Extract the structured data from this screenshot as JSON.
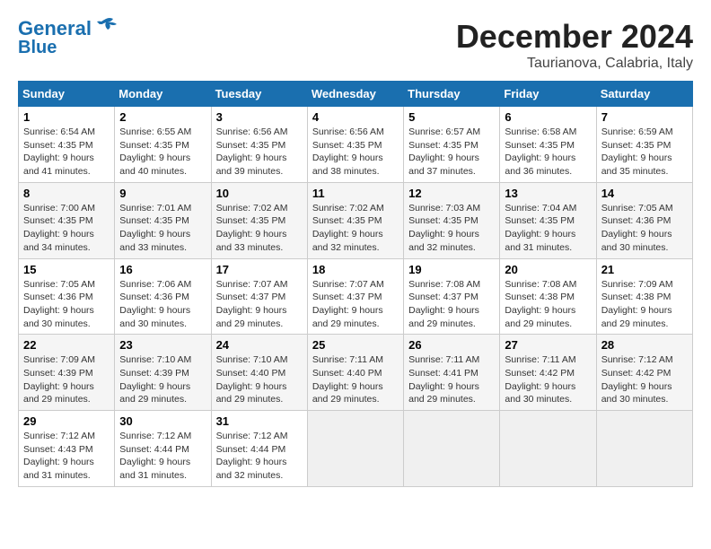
{
  "header": {
    "logo_line1": "General",
    "logo_line2": "Blue",
    "month": "December 2024",
    "location": "Taurianova, Calabria, Italy"
  },
  "weekdays": [
    "Sunday",
    "Monday",
    "Tuesday",
    "Wednesday",
    "Thursday",
    "Friday",
    "Saturday"
  ],
  "weeks": [
    [
      {
        "day": "1",
        "sunrise": "6:54 AM",
        "sunset": "4:35 PM",
        "daylight": "9 hours and 41 minutes."
      },
      {
        "day": "2",
        "sunrise": "6:55 AM",
        "sunset": "4:35 PM",
        "daylight": "9 hours and 40 minutes."
      },
      {
        "day": "3",
        "sunrise": "6:56 AM",
        "sunset": "4:35 PM",
        "daylight": "9 hours and 39 minutes."
      },
      {
        "day": "4",
        "sunrise": "6:56 AM",
        "sunset": "4:35 PM",
        "daylight": "9 hours and 38 minutes."
      },
      {
        "day": "5",
        "sunrise": "6:57 AM",
        "sunset": "4:35 PM",
        "daylight": "9 hours and 37 minutes."
      },
      {
        "day": "6",
        "sunrise": "6:58 AM",
        "sunset": "4:35 PM",
        "daylight": "9 hours and 36 minutes."
      },
      {
        "day": "7",
        "sunrise": "6:59 AM",
        "sunset": "4:35 PM",
        "daylight": "9 hours and 35 minutes."
      }
    ],
    [
      {
        "day": "8",
        "sunrise": "7:00 AM",
        "sunset": "4:35 PM",
        "daylight": "9 hours and 34 minutes."
      },
      {
        "day": "9",
        "sunrise": "7:01 AM",
        "sunset": "4:35 PM",
        "daylight": "9 hours and 33 minutes."
      },
      {
        "day": "10",
        "sunrise": "7:02 AM",
        "sunset": "4:35 PM",
        "daylight": "9 hours and 33 minutes."
      },
      {
        "day": "11",
        "sunrise": "7:02 AM",
        "sunset": "4:35 PM",
        "daylight": "9 hours and 32 minutes."
      },
      {
        "day": "12",
        "sunrise": "7:03 AM",
        "sunset": "4:35 PM",
        "daylight": "9 hours and 32 minutes."
      },
      {
        "day": "13",
        "sunrise": "7:04 AM",
        "sunset": "4:35 PM",
        "daylight": "9 hours and 31 minutes."
      },
      {
        "day": "14",
        "sunrise": "7:05 AM",
        "sunset": "4:36 PM",
        "daylight": "9 hours and 30 minutes."
      }
    ],
    [
      {
        "day": "15",
        "sunrise": "7:05 AM",
        "sunset": "4:36 PM",
        "daylight": "9 hours and 30 minutes."
      },
      {
        "day": "16",
        "sunrise": "7:06 AM",
        "sunset": "4:36 PM",
        "daylight": "9 hours and 30 minutes."
      },
      {
        "day": "17",
        "sunrise": "7:07 AM",
        "sunset": "4:37 PM",
        "daylight": "9 hours and 29 minutes."
      },
      {
        "day": "18",
        "sunrise": "7:07 AM",
        "sunset": "4:37 PM",
        "daylight": "9 hours and 29 minutes."
      },
      {
        "day": "19",
        "sunrise": "7:08 AM",
        "sunset": "4:37 PM",
        "daylight": "9 hours and 29 minutes."
      },
      {
        "day": "20",
        "sunrise": "7:08 AM",
        "sunset": "4:38 PM",
        "daylight": "9 hours and 29 minutes."
      },
      {
        "day": "21",
        "sunrise": "7:09 AM",
        "sunset": "4:38 PM",
        "daylight": "9 hours and 29 minutes."
      }
    ],
    [
      {
        "day": "22",
        "sunrise": "7:09 AM",
        "sunset": "4:39 PM",
        "daylight": "9 hours and 29 minutes."
      },
      {
        "day": "23",
        "sunrise": "7:10 AM",
        "sunset": "4:39 PM",
        "daylight": "9 hours and 29 minutes."
      },
      {
        "day": "24",
        "sunrise": "7:10 AM",
        "sunset": "4:40 PM",
        "daylight": "9 hours and 29 minutes."
      },
      {
        "day": "25",
        "sunrise": "7:11 AM",
        "sunset": "4:40 PM",
        "daylight": "9 hours and 29 minutes."
      },
      {
        "day": "26",
        "sunrise": "7:11 AM",
        "sunset": "4:41 PM",
        "daylight": "9 hours and 29 minutes."
      },
      {
        "day": "27",
        "sunrise": "7:11 AM",
        "sunset": "4:42 PM",
        "daylight": "9 hours and 30 minutes."
      },
      {
        "day": "28",
        "sunrise": "7:12 AM",
        "sunset": "4:42 PM",
        "daylight": "9 hours and 30 minutes."
      }
    ],
    [
      {
        "day": "29",
        "sunrise": "7:12 AM",
        "sunset": "4:43 PM",
        "daylight": "9 hours and 31 minutes."
      },
      {
        "day": "30",
        "sunrise": "7:12 AM",
        "sunset": "4:44 PM",
        "daylight": "9 hours and 31 minutes."
      },
      {
        "day": "31",
        "sunrise": "7:12 AM",
        "sunset": "4:44 PM",
        "daylight": "9 hours and 32 minutes."
      },
      null,
      null,
      null,
      null
    ]
  ]
}
